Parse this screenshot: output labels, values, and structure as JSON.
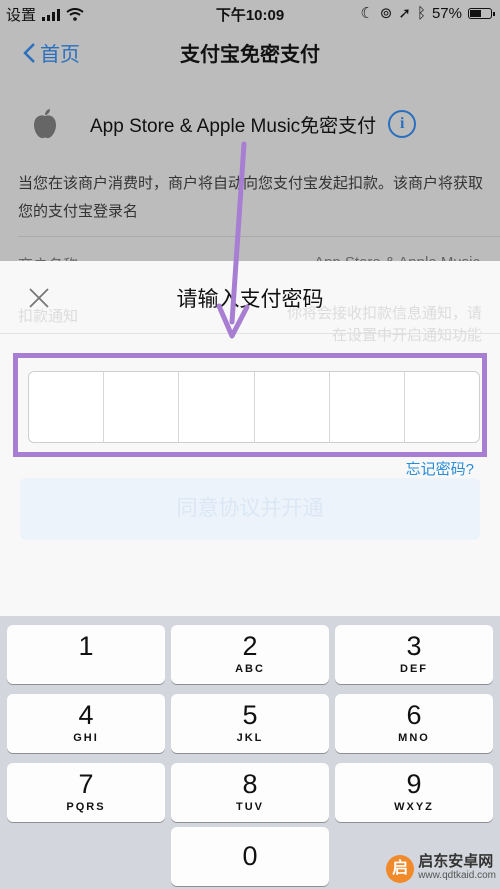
{
  "status_bar": {
    "carrier": "设置",
    "time": "下午10:09",
    "battery": "57%",
    "battery_level": 0.57,
    "signal_bars": 4
  },
  "nav": {
    "back_label": "首页",
    "title": "支付宝免密支付"
  },
  "merchant": {
    "name": "App Store & Apple Music免密支付",
    "info_icon": "info-icon",
    "logo_icon": "apple-logo-icon"
  },
  "description": "当您在该商户消费时，商户将自动向您支付宝发起扣款。该商户将获取您的支付宝登录名",
  "rows": [
    {
      "label": "商户名称",
      "value": "App Store & Apple Music"
    },
    {
      "label": "扣款通知",
      "value": "你将会接收扣款信息通知，请在设置中开启通知功能"
    }
  ],
  "modal": {
    "title": "请输入支付密码",
    "close_icon": "close-icon",
    "pin_length": 6,
    "forgot_label": "忘记密码?",
    "agree_button": "同意协议并开通"
  },
  "keypad": [
    {
      "num": "1",
      "letters": ""
    },
    {
      "num": "2",
      "letters": "ABC"
    },
    {
      "num": "3",
      "letters": "DEF"
    },
    {
      "num": "4",
      "letters": "GHI"
    },
    {
      "num": "5",
      "letters": "JKL"
    },
    {
      "num": "6",
      "letters": "MNO"
    },
    {
      "num": "7",
      "letters": "PQRS"
    },
    {
      "num": "8",
      "letters": "TUV"
    },
    {
      "num": "9",
      "letters": "WXYZ"
    },
    {
      "num": "0",
      "letters": ""
    }
  ],
  "watermark": {
    "logo_glyph": "启",
    "name": "启东安卓网",
    "url": "www.qdtkaid.com"
  },
  "colors": {
    "accent_blue": "#2a6fbf",
    "highlight_purple": "#a77ed2"
  }
}
